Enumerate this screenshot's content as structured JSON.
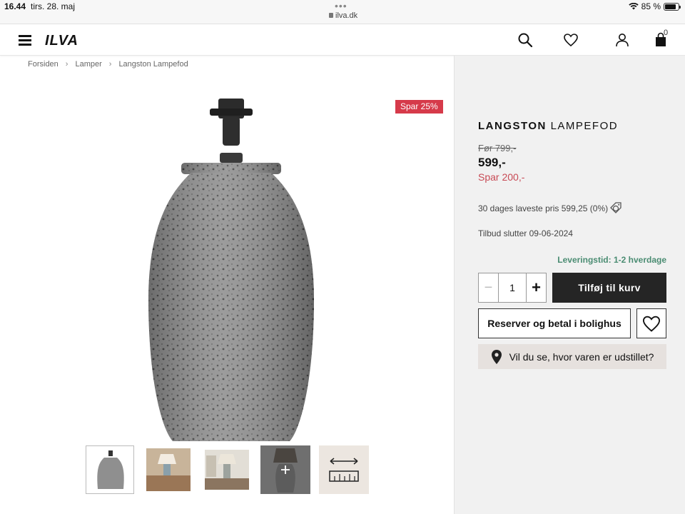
{
  "status_bar": {
    "time": "16.44",
    "date": "tirs. 28. maj",
    "dots": "•••",
    "url": "ilva.dk",
    "battery": "85 %"
  },
  "nav": {
    "logo": "ILVA",
    "cart_count": "0",
    "icons": [
      "menu-icon",
      "search-icon",
      "heart-icon",
      "user-icon",
      "bag-icon"
    ]
  },
  "breadcrumb": {
    "items": [
      "Forsiden",
      "Lamper",
      "Langston Lampefod"
    ],
    "separator": "›"
  },
  "product": {
    "badge": "Spar 25%",
    "name_strong": "LANGSTON",
    "name_rest": "LAMPEFOD",
    "old_price": "Før 799,-",
    "price": "599,-",
    "savings": "Spar 200,-",
    "lowest_price": "30 dages laveste pris 599,25 (0%)",
    "offer_end": "Tilbud slutter 09-06-2024",
    "delivery": "Leveringstid: 1-2 hverdage",
    "quantity": "1",
    "add_to_cart": "Tilføj til kurv",
    "reserve": "Reserver og betal i bolighus",
    "showroom": "Vil du se, hvor varen er udstillet?"
  },
  "colors": {
    "badge": "#d63a4a",
    "savings": "#c84a55",
    "delivery": "#4a8c72",
    "button_dark": "#252525",
    "panel_bg": "#f1f1f1",
    "showroom_bg": "#e6e1de"
  }
}
